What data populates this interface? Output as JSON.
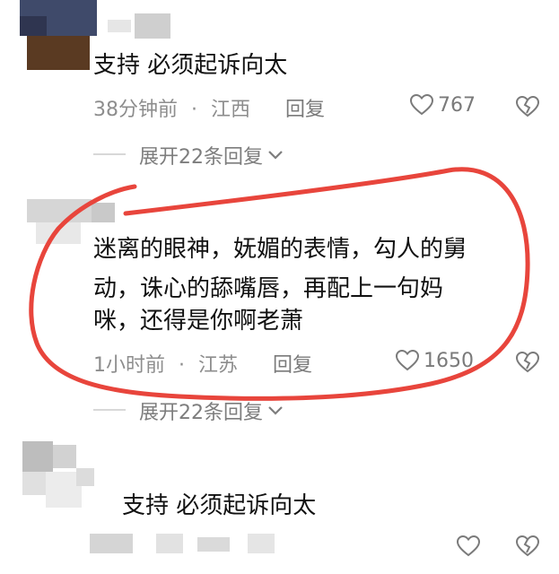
{
  "comments": [
    {
      "text": "支持 必须起诉向太",
      "time": "38分钟前",
      "dot": "·",
      "location": "江西",
      "reply_label": "回复",
      "likes": "767",
      "expand_label": "展开22条回复"
    },
    {
      "lines": [
        "迷离的眼神，妩媚的表情，勾人的舅",
        "动，诛心的舔嘴唇，再配上一句妈",
        "咪，还得是你啊老萧"
      ],
      "time": "1小时前",
      "dot": "·",
      "location": "江苏",
      "reply_label": "回复",
      "likes": "1650",
      "expand_label": "展开22条回复"
    },
    {
      "text": "支持 必须起诉向太"
    }
  ],
  "colors": {
    "annotation": "#e8453c",
    "muted_text": "#8d8d8d",
    "icon": "#7a7a7a"
  },
  "icons": [
    "heart-icon",
    "broken-heart-icon",
    "chevron-down-icon"
  ]
}
